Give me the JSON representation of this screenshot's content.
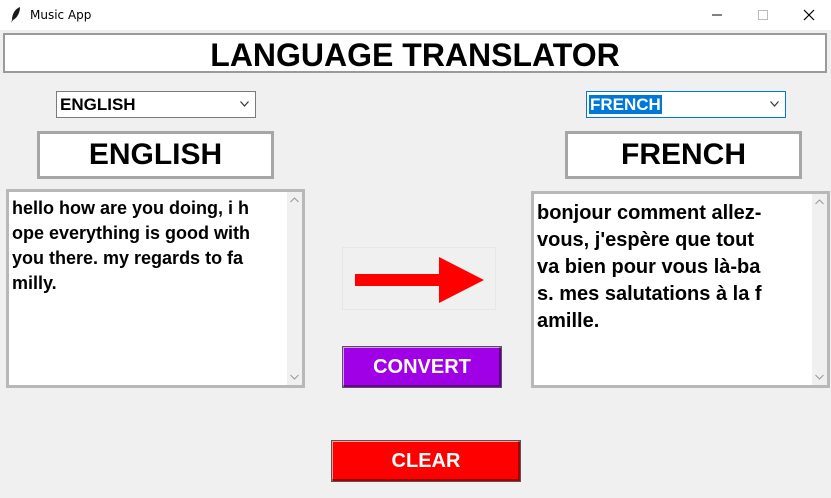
{
  "window": {
    "title": "Music App"
  },
  "header": {
    "title": "LANGUAGE TRANSLATOR"
  },
  "source": {
    "combo_value": "ENGLISH",
    "label": "ENGLISH",
    "text_lines": [
      "hello how are you doing, i h",
      "ope everything is good with",
      "you there. my regards to fa",
      "milly."
    ]
  },
  "target": {
    "combo_value": "FRENCH",
    "label": "FRENCH",
    "text_lines": [
      "bonjour comment allez-",
      "vous, j'espère que tout",
      "va bien pour vous là-ba",
      "s. mes salutations à la f",
      "amille."
    ]
  },
  "buttons": {
    "convert": "CONVERT",
    "clear": "CLEAR"
  },
  "colors": {
    "convert_bg": "#a000e6",
    "clear_bg": "#ff0000",
    "arrow": "#ff0000",
    "selection": "#0078d7"
  },
  "icons": {
    "app": "feather-icon",
    "arrow": "right-arrow-icon"
  }
}
